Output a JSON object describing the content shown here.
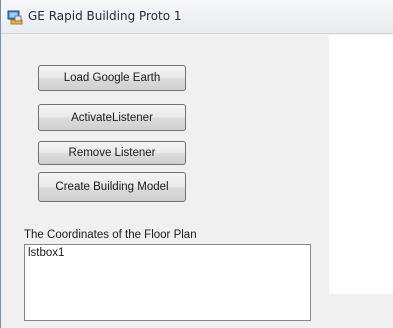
{
  "window": {
    "title": "GE Rapid Building Proto 1"
  },
  "buttons": {
    "load_label": "Load Google Earth",
    "activate_label": "ActivateListener",
    "remove_label": "Remove Listener",
    "create_label": "Create Building Model"
  },
  "coordinates": {
    "label": "The Coordinates of the Floor Plan",
    "items": [
      "lstbox1"
    ]
  },
  "colors": {
    "form_background": "#f0f0f0",
    "panel_background": "#ffffff"
  }
}
